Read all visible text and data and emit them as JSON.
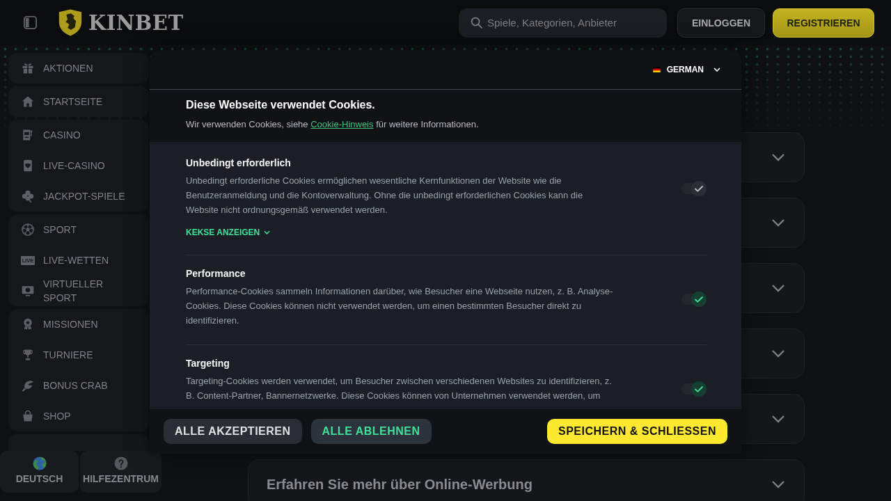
{
  "header": {
    "logo_text": "KINBET",
    "search": {
      "placeholder": "Spiele, Kategorien, Anbieter"
    },
    "buttons": [
      {
        "label": "EINLOGGEN",
        "kind": "secondary"
      },
      {
        "label": "REGISTRIEREN",
        "kind": "primary"
      }
    ]
  },
  "sidebar": {
    "groups": [
      {
        "items": [
          {
            "label": "AKTIONEN",
            "selected": false
          }
        ]
      },
      {
        "items": [
          {
            "label": "STARTSEITE",
            "selected": false
          }
        ]
      },
      {
        "items": [
          {
            "label": "CASINO",
            "selected": false
          },
          {
            "label": "LIVE-CASINO",
            "selected": false
          },
          {
            "label": "JACKPOT-SPIELE",
            "selected": false
          }
        ]
      },
      {
        "items": [
          {
            "label": "SPORT",
            "selected": false
          },
          {
            "label": "LIVE-WETTEN",
            "selected": false,
            "badge": "LIVE"
          },
          {
            "label": "VIRTUELLER SPORT",
            "selected": false
          }
        ]
      },
      {
        "items": [
          {
            "label": "MISSIONEN",
            "selected": false
          },
          {
            "label": "TURNIERE",
            "selected": false
          },
          {
            "label": "BONUS CRAB",
            "selected": false
          },
          {
            "label": "SHOP",
            "selected": false
          }
        ]
      }
    ],
    "footer": [
      {
        "label": "DEUTSCH"
      },
      {
        "label": "HILFEZENTRUM"
      }
    ]
  },
  "accordion": [
    {
      "expanded": false
    },
    {
      "expanded": false
    },
    {
      "expanded": false
    },
    {
      "expanded": false
    },
    {
      "expanded": false
    },
    {
      "title": "Erfahren Sie mehr über Online-Werbung",
      "expanded": false
    }
  ],
  "cookie_dialog": {
    "language": {
      "label": "GERMAN",
      "expanded": false
    },
    "title": "Diese Webseite verwendet Cookies.",
    "intro": {
      "text_before": "Wir verwenden Cookies, siehe",
      "link": "Cookie-Hinweis",
      "text_after": "für weitere Informationen."
    },
    "categories": [
      {
        "title": "Unbedingt erforderlich",
        "description": "Unbedingt erforderliche Cookies ermöglichen wesentliche Kernfunktionen der Website wie die Benutzeranmeldung und die Kontoverwaltung. Ohne die unbedingt erforderlichen Cookies kann die Website nicht ordnungsgemäß verwendet werden.",
        "checked": true,
        "disabled": true,
        "details": {
          "label": "KEKSE ANZEIGEN",
          "expanded": false
        }
      },
      {
        "title": "Performance",
        "description": "Performance-Cookies sammeln Informationen darüber, wie Besucher eine Webseite nutzen, z. B. Analyse-Cookies. Diese Cookies können nicht verwendet werden, um einen bestimmten Besucher direkt zu identifizieren.",
        "checked": true,
        "disabled": false
      },
      {
        "title": "Targeting",
        "description": "Targeting-Cookies werden verwendet, um Besucher zwischen verschiedenen Websites zu identifizieren, z. B. Content-Partner, Bannernetzwerke. Diese Cookies können von Unternehmen verwendet werden, um",
        "checked": true,
        "disabled": false
      }
    ],
    "buttons": [
      {
        "label": "ALLE AKZEPTIEREN",
        "kind": "neutral"
      },
      {
        "label": "ALLE ABLEHNEN",
        "kind": "accent"
      },
      {
        "label": "SPEICHERN & SCHLIESSEN",
        "kind": "primary"
      }
    ]
  }
}
